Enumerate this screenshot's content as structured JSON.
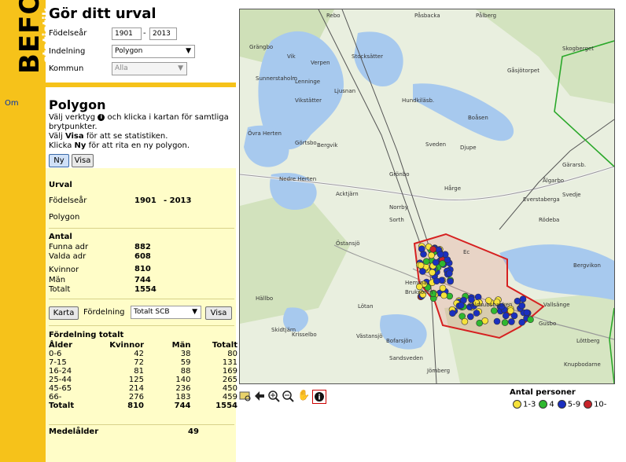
{
  "app": {
    "logo_main": "BEFO",
    "logo_sub": "statistik",
    "nav_om": "Om"
  },
  "selection": {
    "title": "Gör ditt urval",
    "birth_year_label": "Födelseår",
    "birth_year_from": "1901",
    "birth_year_sep": "-",
    "birth_year_to": "2013",
    "division_label": "Indelning",
    "division_value": "Polygon",
    "municipality_label": "Kommun",
    "municipality_value": "Alla"
  },
  "polygon": {
    "title": "Polygon",
    "instr_1a": "Välj verktyg",
    "instr_1b": "och klicka i kartan för samtliga brytpunkter.",
    "instr_2a": "Välj",
    "instr_2b": "Visa",
    "instr_2c": "för att se statistiken.",
    "instr_3a": "Klicka",
    "instr_3b": "Ny",
    "instr_3c": "för att rita en ny polygon.",
    "btn_new": "Ny",
    "btn_show": "Visa"
  },
  "result": {
    "urval_heading": "Urval",
    "birth_year_label": "Födelseår",
    "birth_year_from": "1901",
    "birth_year_to": "- 2013",
    "division": "Polygon",
    "count_heading": "Antal",
    "found_label": "Funna adr",
    "found_value": "882",
    "selected_label": "Valda adr",
    "selected_value": "608",
    "women_label": "Kvinnor",
    "women_value": "810",
    "men_label": "Män",
    "men_value": "744",
    "total_label": "Totalt",
    "total_value": "1554",
    "btn_map": "Karta",
    "distribution_label": "Fördelning",
    "distribution_value": "Totalt SCB",
    "btn_show": "Visa",
    "dist_heading": "Fördelning totalt",
    "columns": [
      "Ålder",
      "Kvinnor",
      "Män",
      "Totalt"
    ],
    "rows": [
      [
        "0-6",
        "42",
        "38",
        "80"
      ],
      [
        "7-15",
        "72",
        "59",
        "131"
      ],
      [
        "16-24",
        "81",
        "88",
        "169"
      ],
      [
        "25-44",
        "125",
        "140",
        "265"
      ],
      [
        "45-65",
        "214",
        "236",
        "450"
      ],
      [
        "66-",
        "276",
        "183",
        "459"
      ]
    ],
    "total_row": [
      "Totalt",
      "810",
      "744",
      "1554"
    ],
    "median_age_label": "Medelålder",
    "median_age_value": "49"
  },
  "map": {
    "places": [
      "Rebo",
      "Påsbacka",
      "Pålberg",
      "Skogberget",
      "Grängbo",
      "Stocksätter",
      "Gåsjötorpet",
      "Vik",
      "Verpen",
      "Sunnerstaholm",
      "Lenninge",
      "Ljusnan",
      "Vikstätter",
      "Hundkiläsb.",
      "Boåsen",
      "Övra Herten",
      "Görtsbo",
      "Bergvik",
      "Sveden",
      "Djupe",
      "Grönbo",
      "Nedre Herten",
      "Acktjärn",
      "Hårge",
      "Gärarsb.",
      "Svedje",
      "Everstaberga",
      "Norrby",
      "Sorth",
      "Rödeba",
      "Ålgarbo",
      "Östansjö",
      "Bergvikon",
      "Hemma",
      "Bruksören",
      "Lötan",
      "Hällbo",
      "Skidtjärn",
      "Krisselbo",
      "Västansjö",
      "Bofarsjön",
      "Vallsänge",
      "Gusbo",
      "Löttberg",
      "Knupbodarne",
      "Sandsveden",
      "Jömberg",
      "Ec",
      "Kaldsubsbacken"
    ]
  },
  "tools": [
    "zoom-extent-icon",
    "pan-back-icon",
    "zoom-in-icon",
    "zoom-out-icon",
    "pan-hand-icon",
    "info-icon"
  ],
  "legend": {
    "title": "Antal personer",
    "items": [
      {
        "label": "1-3",
        "color": "#f6e23a"
      },
      {
        "label": "4",
        "color": "#2fb82f"
      },
      {
        "label": "5-9",
        "color": "#1a2fbf"
      },
      {
        "label": "10-",
        "color": "#c8232a"
      }
    ]
  }
}
